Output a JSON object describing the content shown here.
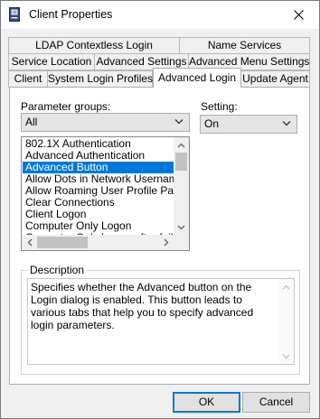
{
  "window": {
    "title": "Client Properties",
    "close_glyph": "✕"
  },
  "tabs": {
    "row1": [
      "LDAP Contextless Login",
      "Name Services"
    ],
    "row2": [
      "Service Location",
      "Advanced Settings",
      "Advanced Menu Settings"
    ],
    "row3": [
      "Client",
      "System Login Profiles",
      "Advanced Login",
      "Update Agent"
    ],
    "active": "Advanced Login"
  },
  "parameter_groups": {
    "label": "Parameter groups:",
    "selected": "All"
  },
  "setting": {
    "label": "Setting:",
    "selected": "On"
  },
  "parameter_list": {
    "items": [
      "802.1X Authentication",
      "Advanced Authentication",
      "Advanced Button",
      "Allow Dots in Network Username",
      "Allow Roaming User Profile Paths t",
      "Clear Connections",
      "Client Logon",
      "Computer Only Logon",
      "Computer Only Logon after failed"
    ],
    "selected_index": 2
  },
  "description": {
    "title": "Description",
    "text": "Specifies whether the Advanced button on the Login dialog is enabled.  This button leads to various tabs that help you to specify advanced login parameters."
  },
  "buttons": {
    "ok": "OK",
    "cancel": "Cancel"
  },
  "colors": {
    "selection": "#0078d7",
    "dialog_bg": "#f0f0f0"
  }
}
